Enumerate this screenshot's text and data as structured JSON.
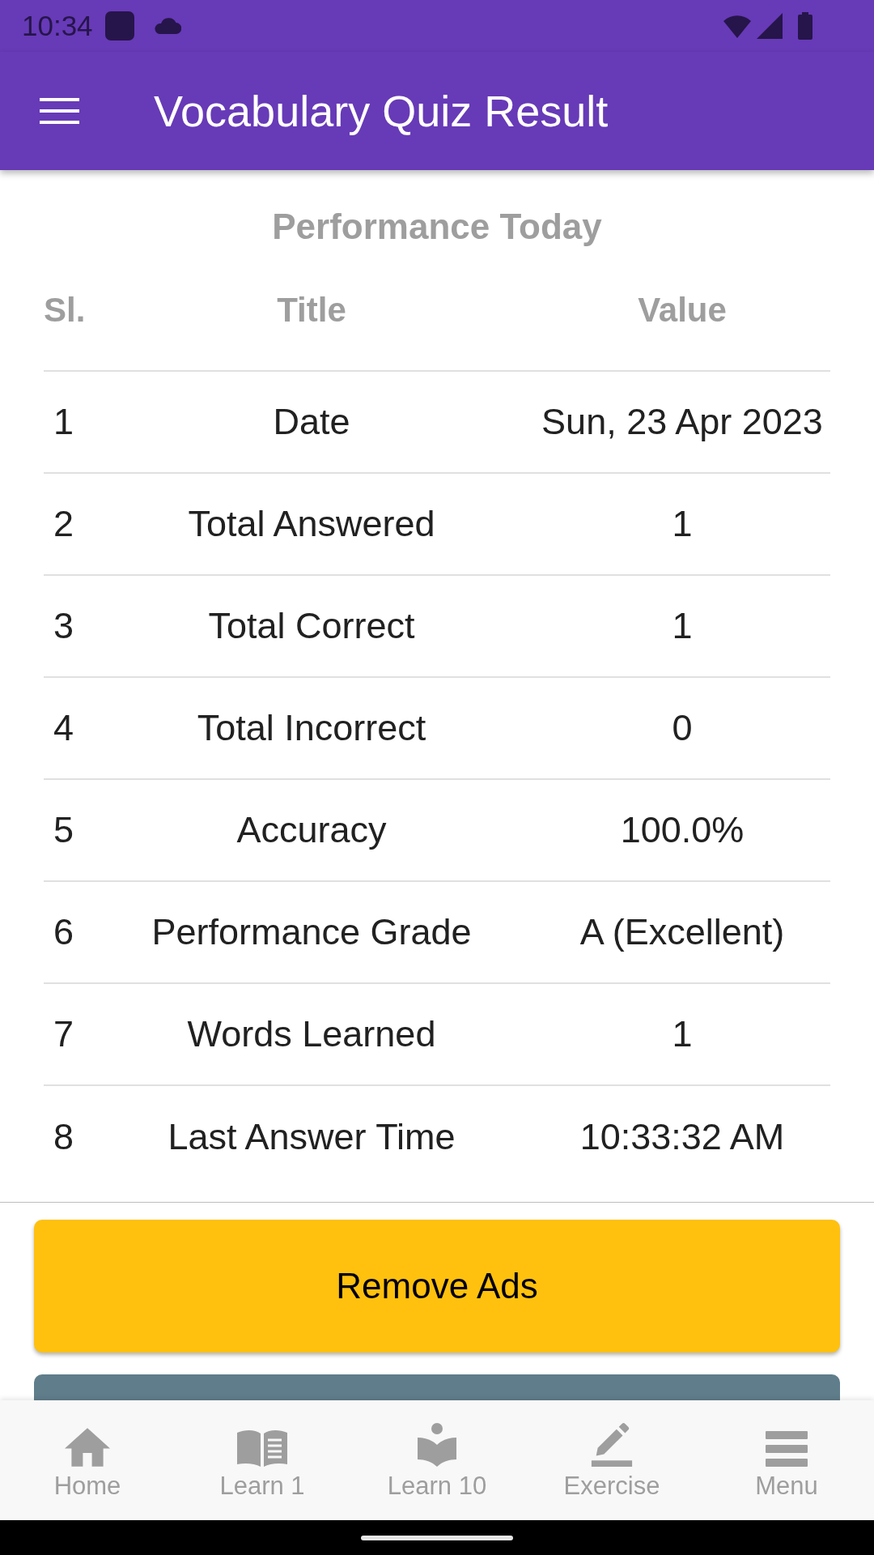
{
  "status_bar": {
    "time": "10:34"
  },
  "app_bar": {
    "title": "Vocabulary Quiz Result"
  },
  "section": {
    "title": "Performance Today"
  },
  "table": {
    "columns": [
      "Sl.",
      "Title",
      "Value"
    ],
    "rows": [
      {
        "sl": "1",
        "title": "Date",
        "value": "Sun, 23 Apr 2023"
      },
      {
        "sl": "2",
        "title": "Total Answered",
        "value": "1"
      },
      {
        "sl": "3",
        "title": "Total Correct",
        "value": "1"
      },
      {
        "sl": "4",
        "title": "Total Incorrect",
        "value": "0"
      },
      {
        "sl": "5",
        "title": "Accuracy",
        "value": "100.0%"
      },
      {
        "sl": "6",
        "title": "Performance Grade",
        "value": "A (Excellent)"
      },
      {
        "sl": "7",
        "title": "Words Learned",
        "value": "1"
      },
      {
        "sl": "8",
        "title": "Last Answer Time",
        "value": "10:33:32 AM"
      }
    ]
  },
  "buttons": [
    {
      "label": "Remove Ads"
    }
  ],
  "bottom_nav": {
    "items": [
      {
        "label": "Home",
        "kind": "home",
        "selected": false
      },
      {
        "label": "Learn 1",
        "kind": "book",
        "selected": false
      },
      {
        "label": "Learn 10",
        "kind": "reader",
        "selected": false
      },
      {
        "label": "Exercise",
        "kind": "pencil",
        "selected": false
      },
      {
        "label": "Menu",
        "kind": "menu",
        "selected": false
      }
    ]
  }
}
